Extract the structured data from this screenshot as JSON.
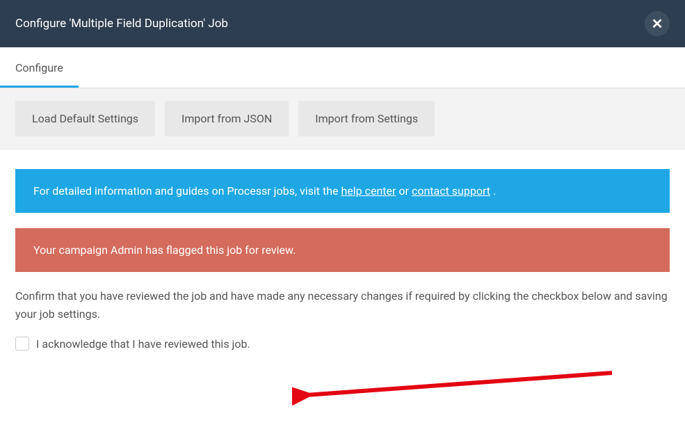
{
  "header": {
    "title": "Configure 'Multiple Field Duplication' Job"
  },
  "tabs": {
    "configure": "Configure"
  },
  "toolbar": {
    "load_defaults": "Load Default Settings",
    "import_json": "Import from JSON",
    "import_settings": "Import from Settings"
  },
  "alerts": {
    "info_prefix": "For detailed information and guides on Processr jobs, visit the ",
    "info_link1": "help center",
    "info_mid": " or ",
    "info_link2": "contact support",
    "info_suffix": " .",
    "warn": "Your campaign Admin has flagged this job for review."
  },
  "body": {
    "instruction": "Confirm that you have reviewed the job and have made any necessary changes if required by clicking the checkbox below and saving your job settings.",
    "checkbox_label": "I acknowledge that I have reviewed this job."
  }
}
